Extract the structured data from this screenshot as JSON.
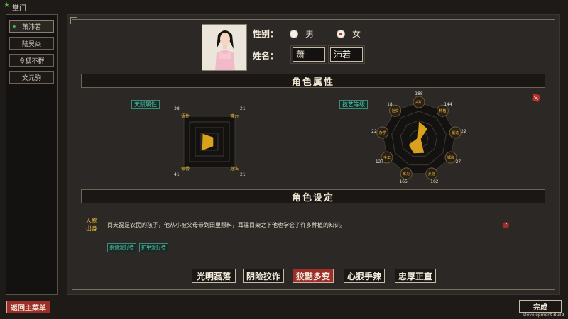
{
  "title_bar": {
    "label": "掌门"
  },
  "sidebar": {
    "items": [
      {
        "label": "萧沛若",
        "active": true
      },
      {
        "label": "陆昊焱"
      },
      {
        "label": "令狐不群"
      },
      {
        "label": "文元驹"
      }
    ]
  },
  "character": {
    "gender_label": "性别：",
    "gender_male": "男",
    "gender_female": "女",
    "gender_selected": "女",
    "name_label": "姓名：",
    "surname": "萧",
    "given_name": "沛若"
  },
  "sections": {
    "attributes": "角色属性",
    "settings": "角色设定"
  },
  "talent": {
    "tag": "天赋属性",
    "stats": [
      {
        "name": "悟性",
        "value": 38
      },
      {
        "name": "膂力",
        "value": 21
      },
      {
        "name": "根骨",
        "value": 41
      },
      {
        "name": "身法",
        "value": 21
      }
    ]
  },
  "skills": {
    "tag": "技艺等级",
    "stats": [
      {
        "name": "采矿",
        "value": 188
      },
      {
        "name": "种植",
        "value": 144
      },
      {
        "name": "锻造",
        "value": 22
      },
      {
        "name": "镶嵌",
        "value": 27
      },
      {
        "name": "烹饪",
        "value": 162
      },
      {
        "name": "炼丹",
        "value": 165
      },
      {
        "name": "手工",
        "value": 127
      },
      {
        "name": "杂学",
        "value": 22
      },
      {
        "name": "社交",
        "value": 18
      }
    ]
  },
  "background": {
    "label_line1": "人物",
    "label_line2": "出身",
    "text": "尚天磊是农民的孩子，他从小被父母带到田里照料，耳濡目染之下他也学会了许多种植的知识。",
    "help": "?",
    "traits": [
      "素食爱好者",
      "护甲爱好者"
    ]
  },
  "personality": {
    "options": [
      "光明磊落",
      "阴险狡诈",
      "狡黠多变",
      "心狠手辣",
      "忠厚正直"
    ],
    "selected": "狡黠多变"
  },
  "footer": {
    "back_button": "返回主菜单",
    "done_button": "完成",
    "build_label": "Development Build"
  },
  "colors": {
    "accent_red": "#9e2e2a",
    "stat_gold": "#f0c040",
    "tag_teal": "#4ec3a8",
    "fill": "#d9a11c"
  }
}
